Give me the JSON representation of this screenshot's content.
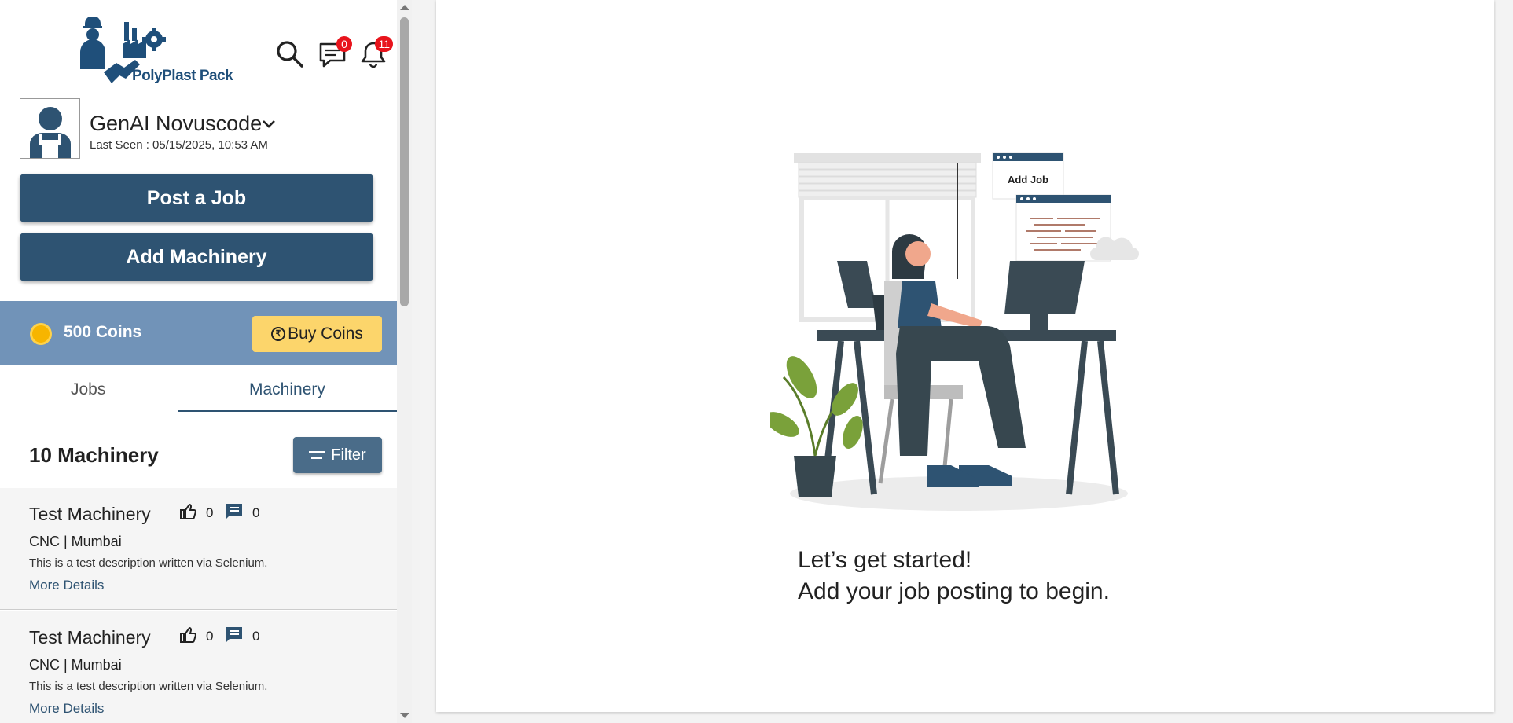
{
  "brand": {
    "name": "PolyPlast Pack"
  },
  "header": {
    "messages_count": "0",
    "notifications_count": "11"
  },
  "user": {
    "name": "GenAI Novuscode",
    "last_seen": "Last Seen : 05/15/2025, 10:53 AM"
  },
  "actions": {
    "post_job": "Post a Job",
    "add_machinery": "Add Machinery"
  },
  "coins": {
    "balance_label": "500 Coins",
    "buy_label": "Buy Coins",
    "rupee_symbol": "₹"
  },
  "tabs": [
    {
      "label": "Jobs",
      "active": false
    },
    {
      "label": "Machinery",
      "active": true
    }
  ],
  "list": {
    "title": "10 Machinery",
    "filter_label": "Filter",
    "items": [
      {
        "title": "Test Machinery",
        "likes": "0",
        "comments": "0",
        "subtitle": "CNC | Mumbai",
        "description": "This is a test description written via Selenium.",
        "link": "More Details"
      },
      {
        "title": "Test Machinery",
        "likes": "0",
        "comments": "0",
        "subtitle": "CNC | Mumbai",
        "description": "This is a test description written via Selenium.",
        "link": "More Details"
      }
    ]
  },
  "empty_state": {
    "badge_label": "Add Job",
    "line1": "Let’s get started!",
    "line2": "Add your job posting to begin."
  },
  "colors": {
    "primary": "#2e5372",
    "coins_bar": "#7193b8",
    "buy_button": "#fcd56b",
    "badge": "#e8141c"
  }
}
